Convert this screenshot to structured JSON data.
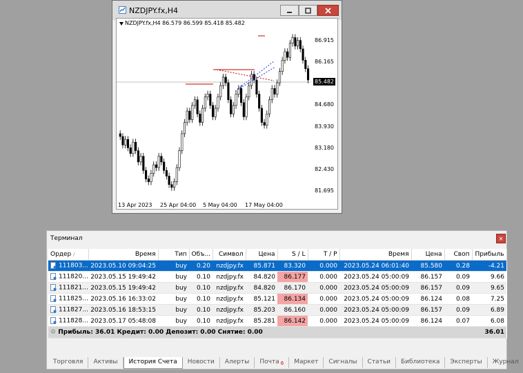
{
  "chart_window": {
    "title": "NZDJPY.fx,H4",
    "header": "NZDJPY.fx,H4  86.579 86.599 85.418 85.482",
    "current_price": "85.482",
    "y_ticks": [
      "86.915",
      "86.165",
      "85.482",
      "84.680",
      "83.930",
      "83.180",
      "82.430",
      "81.695"
    ],
    "x_ticks": [
      "13 Apr 2023",
      "25 Apr 04:00",
      "5 May 04:00",
      "17 May 04:00"
    ]
  },
  "terminal": {
    "title": "Терминал",
    "close_label": "×",
    "columns": [
      "Ордер",
      "Время",
      "Тип",
      "Объ...",
      "Символ",
      "Цена",
      "S / L",
      "T / P",
      "Время",
      "Цена",
      "Своп",
      "Прибыль"
    ],
    "rows": [
      [
        "111803...",
        "2023.05.10 09:04:25",
        "buy",
        "0.20",
        "nzdjpy.fx",
        "85.871",
        "83.320",
        "0.000",
        "2023.05.24 06:01:40",
        "85.580",
        "0.28",
        "-4.21"
      ],
      [
        "111820...",
        "2023.05.15 19:49:42",
        "buy",
        "0.10",
        "nzdjpy.fx",
        "84.820",
        "86.177",
        "0.000",
        "2023.05.24 05:00:09",
        "86.157",
        "0.09",
        "9.66"
      ],
      [
        "111821...",
        "2023.05.15 19:49:42",
        "buy",
        "0.10",
        "nzdjpy.fx",
        "84.820",
        "86.170",
        "0.000",
        "2023.05.24 05:00:09",
        "86.157",
        "0.09",
        "9.65"
      ],
      [
        "111825...",
        "2023.05.16 16:33:02",
        "buy",
        "0.10",
        "nzdjpy.fx",
        "85.121",
        "86.134",
        "0.000",
        "2023.05.24 05:00:09",
        "86.124",
        "0.08",
        "7.25"
      ],
      [
        "111827...",
        "2023.05.16 18:53:15",
        "buy",
        "0.10",
        "nzdjpy.fx",
        "85.203",
        "86.160",
        "0.000",
        "2023.05.24 05:00:09",
        "86.157",
        "0.09",
        "6.89"
      ],
      [
        "111828...",
        "2023.05.17 05:48:08",
        "buy",
        "0.10",
        "nzdjpy.fx",
        "85.281",
        "86.142",
        "0.000",
        "2023.05.24 05:00:09",
        "86.124",
        "0.07",
        "6.08"
      ]
    ],
    "summary": "Прибыль: 36.01  Кредит: 0.00  Депозит: 0.00  Снятие: 0.00",
    "summary_total": "36.01",
    "tabs": [
      "Торговля",
      "Активы",
      "История Счета",
      "Новости",
      "Алерты",
      "Почта",
      "Маркет",
      "Сигналы",
      "Статьи",
      "Библиотека",
      "Эксперты",
      "Журнал"
    ],
    "active_tab": "История Счета",
    "mail_badge": "6"
  },
  "colors": {
    "selected_row": "#0a6bc9",
    "sl_highlight": "#f4a4a4",
    "close_button": "#c9463d"
  }
}
